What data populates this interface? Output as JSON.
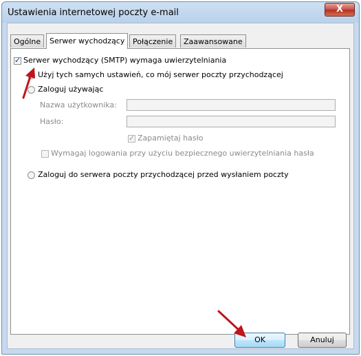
{
  "window": {
    "title": "Ustawienia internetowej poczty e-mail",
    "close_label": "X"
  },
  "tabs": [
    {
      "label": "Ogólne",
      "active": false
    },
    {
      "label": "Serwer wychodzący",
      "active": true
    },
    {
      "label": "Połączenie",
      "active": false
    },
    {
      "label": "Zaawansowane",
      "active": false
    }
  ],
  "outgoing": {
    "smtp_auth_label": "Serwer wychodzący (SMTP) wymaga uwierzytelniania",
    "smtp_auth_checked": true,
    "use_same_settings_label": "Użyj tych samych ustawień, co mój serwer poczty przychodzącej",
    "log_on_using_label": "Zaloguj używając",
    "username_label": "Nazwa użytkownika:",
    "username_value": "",
    "password_label": "Hasło:",
    "password_value": "",
    "remember_password_label": "Zapamiętaj hasło",
    "remember_password_checked": true,
    "spa_label": "Wymagaj logowania przy użyciu bezpiecznego uwierzytelniania hasła",
    "spa_checked": false,
    "log_on_incoming_label": "Zaloguj do serwera poczty przychodzącej przed wysłaniem poczty"
  },
  "buttons": {
    "ok_label": "OK",
    "cancel_label": "Anuluj"
  },
  "colors": {
    "annotation_arrow": "#c0141c",
    "title_bar": "#b9d1ea",
    "close_button": "#c75050"
  }
}
